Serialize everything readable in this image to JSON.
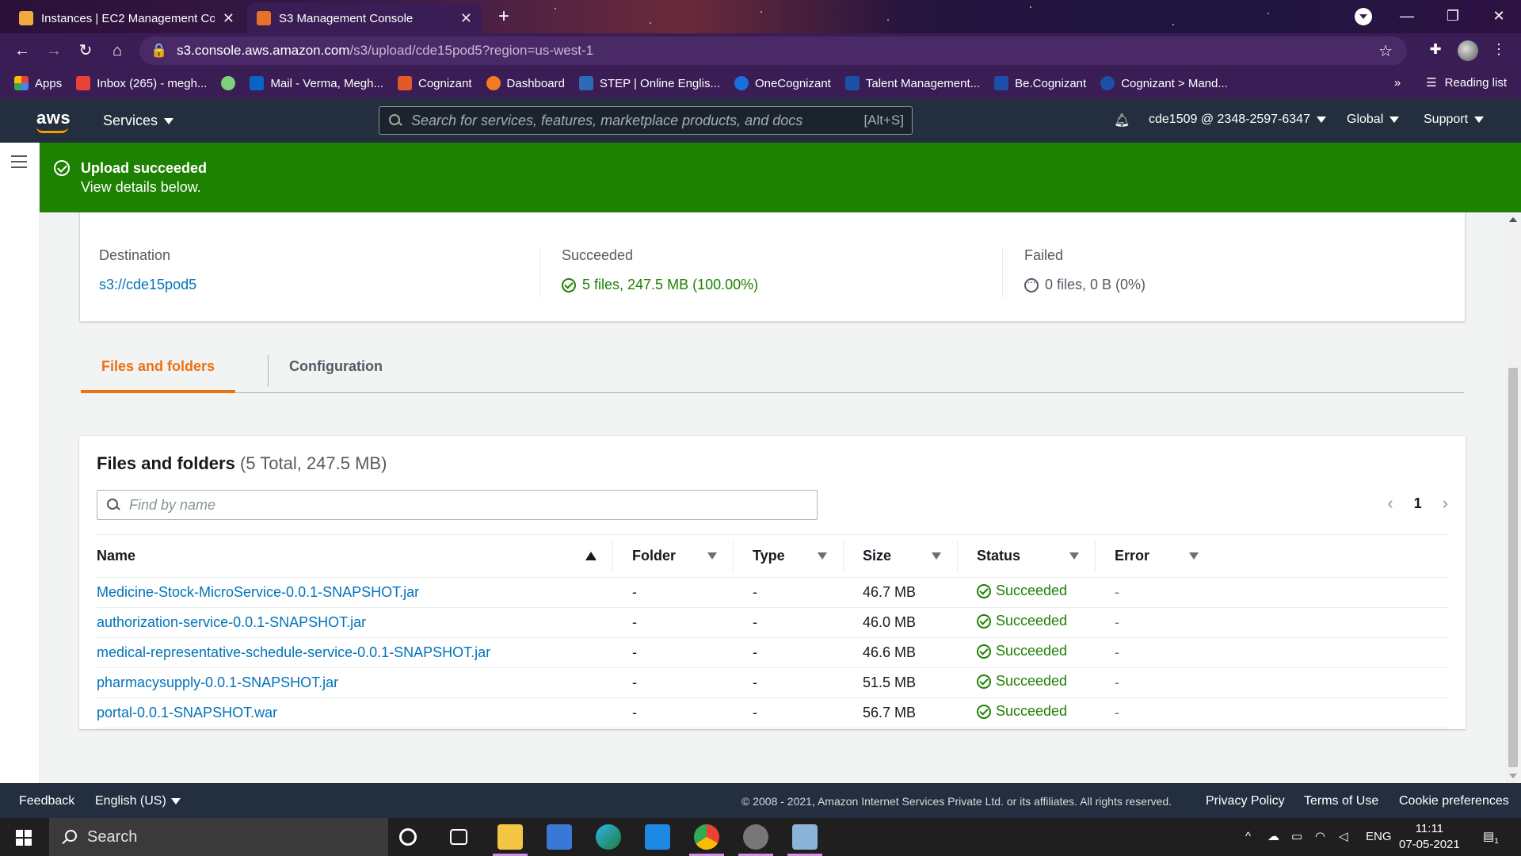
{
  "browser": {
    "tabs": [
      {
        "title": "Instances | EC2 Management Con",
        "active": false
      },
      {
        "title": "S3 Management Console",
        "active": true
      }
    ],
    "url_host": "s3.console.aws.amazon.com",
    "url_path": "/s3/upload/cde15pod5?region=us-west-1",
    "bookmarks": [
      {
        "label": "Apps",
        "color": "#4285f4"
      },
      {
        "label": "Inbox (265) - megh...",
        "color": "#ea4335"
      },
      {
        "label": "",
        "color": "#7cd17a"
      },
      {
        "label": "Mail - Verma, Megh...",
        "color": "#0a64c4"
      },
      {
        "label": "Cognizant",
        "color": "#e05a2b"
      },
      {
        "label": "Dashboard",
        "color": "#f47b20"
      },
      {
        "label": "STEP | Online Englis...",
        "color": "#2d6cb5"
      },
      {
        "label": "OneCognizant",
        "color": "#1a6fe0"
      },
      {
        "label": "Talent Management...",
        "color": "#1b4fa8"
      },
      {
        "label": "Be.Cognizant",
        "color": "#1b4fa8"
      },
      {
        "label": "Cognizant > Mand...",
        "color": "#1b4fa8"
      }
    ],
    "bookmarks_more": "»",
    "reading_list": "Reading list"
  },
  "aws": {
    "logo": "aws",
    "services": "Services",
    "search_placeholder": "Search for services, features, marketplace products, and docs",
    "search_shortcut": "[Alt+S]",
    "account": "cde1509 @ 2348-2597-6347",
    "region": "Global",
    "support": "Support"
  },
  "banner": {
    "title": "Upload succeeded",
    "subtitle": "View details below."
  },
  "summary": {
    "destination_label": "Destination",
    "destination_value": "s3://cde15pod5",
    "succeeded_label": "Succeeded",
    "succeeded_value": "5 files, 247.5 MB (100.00%)",
    "failed_label": "Failed",
    "failed_value": "0 files, 0 B (0%)"
  },
  "tabs": {
    "files": "Files and folders",
    "config": "Configuration"
  },
  "files": {
    "title": "Files and folders",
    "count": "(5 Total, 247.5 MB)",
    "find_placeholder": "Find by name",
    "page": "1",
    "prev": "‹",
    "next": "›",
    "columns": [
      "Name",
      "Folder",
      "Type",
      "Size",
      "Status",
      "Error"
    ],
    "rows": [
      {
        "name": "Medicine-Stock-MicroService-0.0.1-SNAPSHOT.jar",
        "folder": "-",
        "type": "-",
        "size": "46.7 MB",
        "status": "Succeeded",
        "error": "-"
      },
      {
        "name": "authorization-service-0.0.1-SNAPSHOT.jar",
        "folder": "-",
        "type": "-",
        "size": "46.0 MB",
        "status": "Succeeded",
        "error": "-"
      },
      {
        "name": "medical-representative-schedule-service-0.0.1-SNAPSHOT.jar",
        "folder": "-",
        "type": "-",
        "size": "46.6 MB",
        "status": "Succeeded",
        "error": "-"
      },
      {
        "name": "pharmacysupply-0.0.1-SNAPSHOT.jar",
        "folder": "-",
        "type": "-",
        "size": "51.5 MB",
        "status": "Succeeded",
        "error": "-"
      },
      {
        "name": "portal-0.0.1-SNAPSHOT.war",
        "folder": "-",
        "type": "-",
        "size": "56.7 MB",
        "status": "Succeeded",
        "error": "-"
      }
    ]
  },
  "footer": {
    "feedback": "Feedback",
    "language": "English (US)",
    "copyright": "© 2008 - 2021, Amazon Internet Services Private Ltd. or its affiliates. All rights reserved.",
    "privacy": "Privacy Policy",
    "terms": "Terms of Use",
    "cookies": "Cookie preferences"
  },
  "taskbar": {
    "search": "Search",
    "lang": "ENG",
    "time": "11:11",
    "date": "07-05-2021",
    "notif_count": "1"
  },
  "colors": {
    "success": "#1d8102",
    "aws_header": "#232f3e",
    "tab_active": "#ec7211",
    "link": "#0073bb"
  }
}
